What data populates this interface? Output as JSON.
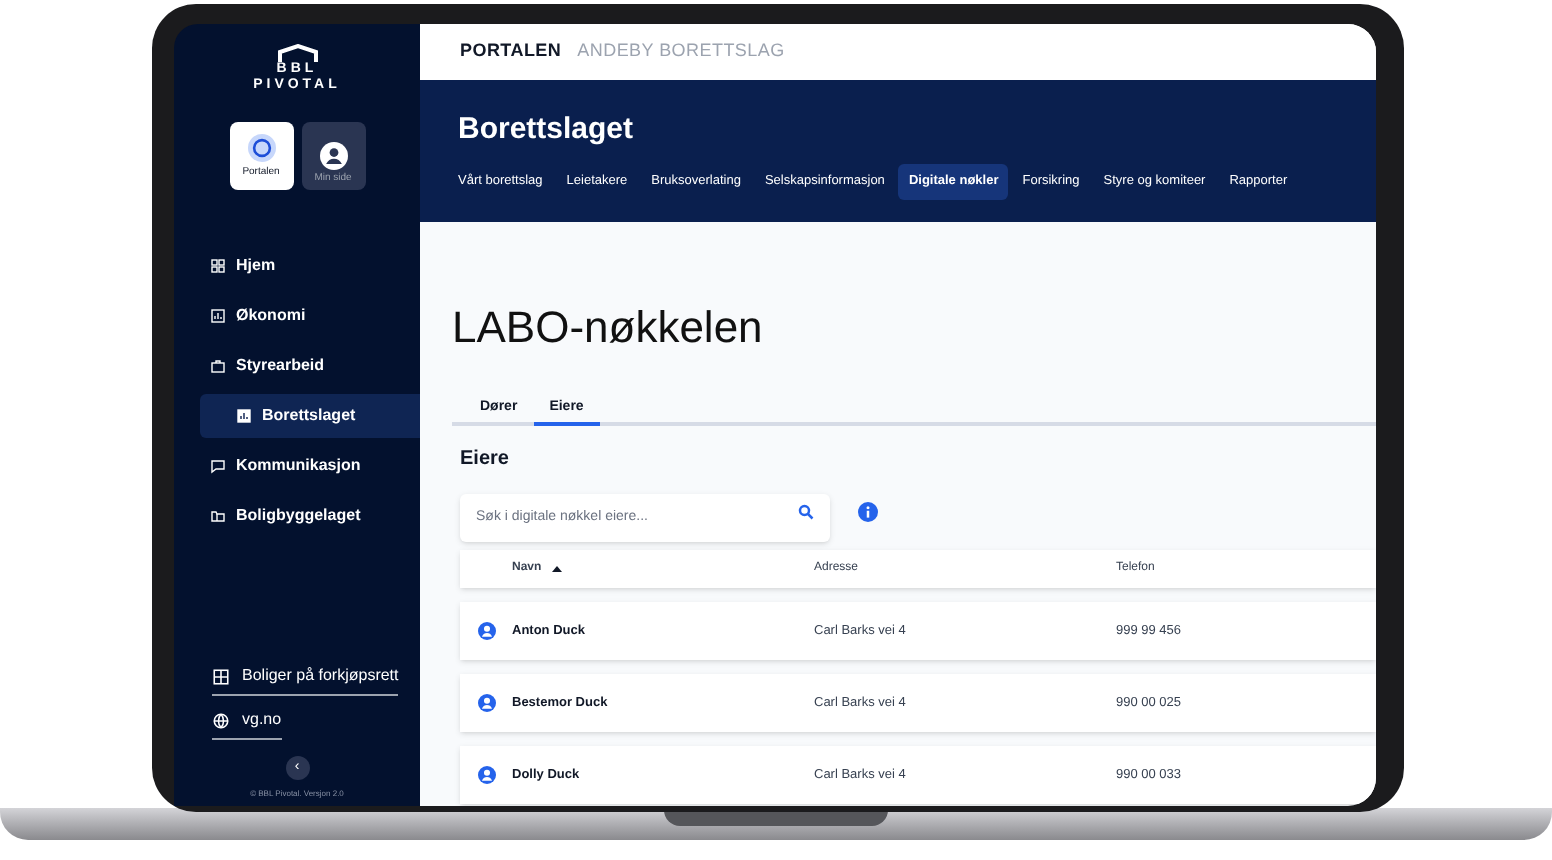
{
  "sidebar": {
    "logo": {
      "line_1": "BBL",
      "line_2": "PIVOTAL"
    },
    "switcher": [
      {
        "label": "Portalen",
        "kind": "portal",
        "selected": true
      },
      {
        "label": "Min side",
        "kind": "user",
        "selected": false
      }
    ],
    "nav": [
      {
        "label": "Hjem",
        "kind": "grid",
        "selected": false
      },
      {
        "label": "Økonomi",
        "kind": "chart",
        "selected": false
      },
      {
        "label": "Styrearbeid",
        "kind": "briefcase",
        "selected": false
      },
      {
        "label": "Borettslaget",
        "kind": "bars",
        "selected": true
      },
      {
        "label": "Kommunikasjon",
        "kind": "chat",
        "selected": false
      },
      {
        "label": "Boligbyggelaget",
        "kind": "folder",
        "selected": false
      }
    ],
    "links": [
      {
        "label": "Boliger på forkjøpsrett",
        "kind": "building"
      },
      {
        "label": "vg.no",
        "kind": "globe"
      }
    ],
    "collapse": "‹",
    "version": "© BBL Pivotal. Versjon 2.0"
  },
  "breadcrumb": [
    {
      "label": "PORTALEN",
      "selected": true
    },
    {
      "label": "ANDEBY BORETTSLAG",
      "selected": false
    }
  ],
  "header": {
    "title": "Borettslaget",
    "tabs": [
      {
        "label": "Vårt borettslag",
        "selected": false
      },
      {
        "label": "Leietakere",
        "selected": false
      },
      {
        "label": "Bruksoverlating",
        "selected": false
      },
      {
        "label": "Selskapsinformasjon",
        "selected": false
      },
      {
        "label": "Digitale nøkler",
        "selected": true
      },
      {
        "label": "Forsikring",
        "selected": false
      },
      {
        "label": "Styre og komiteer",
        "selected": false
      },
      {
        "label": "Rapporter",
        "selected": false
      }
    ]
  },
  "content": {
    "title": "LABO-nøkkelen",
    "tabs": [
      {
        "label": "Dører",
        "selected": false
      },
      {
        "label": "Eiere",
        "selected": true
      }
    ],
    "section_title": "Eiere",
    "search": {
      "placeholder": "Søk i digitale nøkkel eiere..."
    },
    "table": {
      "columns": [
        {
          "label": "Navn",
          "sorted": true
        },
        {
          "label": "Adresse",
          "sorted": false
        },
        {
          "label": "Telefon",
          "sorted": false
        }
      ],
      "rows": [
        {
          "name": "Anton Duck",
          "address": "Carl Barks vei 4",
          "phone": "999 99 456"
        },
        {
          "name": "Bestemor Duck",
          "address": "Carl Barks vei 4",
          "phone": "990 00 025"
        },
        {
          "name": "Dolly Duck",
          "address": "Carl Barks vei 4",
          "phone": "990 00 033"
        }
      ]
    }
  }
}
